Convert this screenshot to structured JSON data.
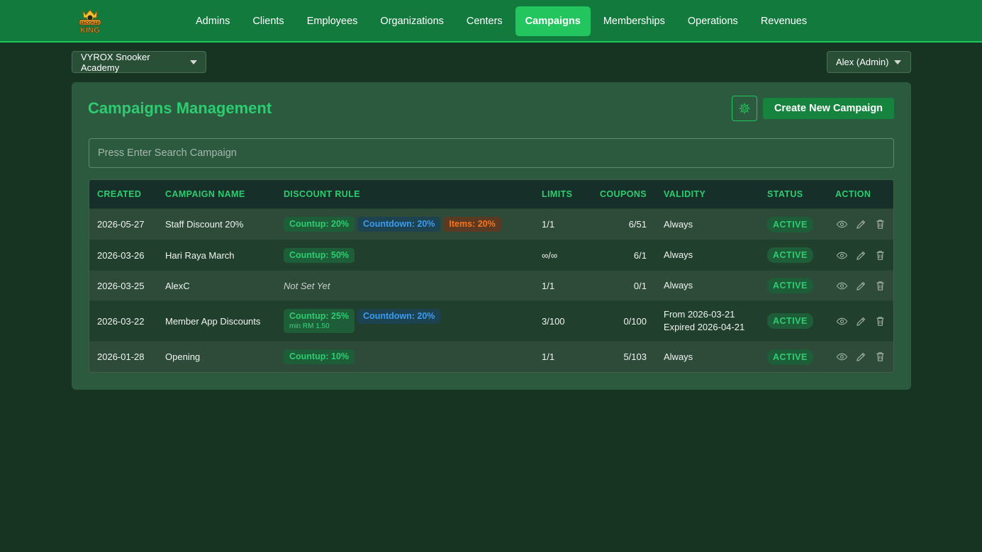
{
  "nav": {
    "logo_text": "SNOOKER KING",
    "items": [
      {
        "label": "Admins",
        "active": false
      },
      {
        "label": "Clients",
        "active": false
      },
      {
        "label": "Employees",
        "active": false
      },
      {
        "label": "Organizations",
        "active": false
      },
      {
        "label": "Centers",
        "active": false
      },
      {
        "label": "Campaigns",
        "active": true
      },
      {
        "label": "Memberships",
        "active": false
      },
      {
        "label": "Operations",
        "active": false
      },
      {
        "label": "Revenues",
        "active": false
      }
    ]
  },
  "org_select": {
    "value": "VYROX Snooker Academy"
  },
  "user_menu": {
    "label": "Alex (Admin)"
  },
  "page": {
    "title": "Campaigns Management",
    "create_label": "Create New Campaign",
    "search_placeholder": "Press Enter Search Campaign"
  },
  "table": {
    "headers": {
      "created": "CREATED",
      "name": "CAMPAIGN NAME",
      "rule": "DISCOUNT RULE",
      "limits": "LIMITS",
      "coupons": "COUPONS",
      "validity": "VALIDITY",
      "status": "STATUS",
      "action": "ACTION"
    },
    "rows": [
      {
        "created": "2026-05-27",
        "name": "Staff Discount 20%",
        "rules": [
          {
            "label": "Countup: 20%",
            "color": "green"
          },
          {
            "label": "Countdown: 20%",
            "color": "blue"
          },
          {
            "label": "Items: 20%",
            "color": "orange"
          }
        ],
        "limits": "1/1",
        "coupons": "6/51",
        "validity": [
          "Always"
        ],
        "status": "ACTIVE"
      },
      {
        "created": "2026-03-26",
        "name": "Hari Raya March",
        "rules": [
          {
            "label": "Countup: 50%",
            "color": "green"
          }
        ],
        "limits": "∞/∞",
        "coupons": "6/1",
        "validity": [
          "Always"
        ],
        "status": "ACTIVE"
      },
      {
        "created": "2026-03-25",
        "name": "AlexC",
        "rules": [],
        "rule_empty": "Not Set Yet",
        "limits": "1/1",
        "coupons": "0/1",
        "validity": [
          "Always"
        ],
        "status": "ACTIVE"
      },
      {
        "created": "2026-03-22",
        "name": "Member App Discounts",
        "rules": [
          {
            "label": "Countup: 25%",
            "sub": "min RM 1.50",
            "color": "green"
          },
          {
            "label": "Countdown: 20%",
            "color": "blue"
          }
        ],
        "limits": "3/100",
        "coupons": "0/100",
        "validity": [
          "From 2026-03-21",
          "Expired 2026-04-21"
        ],
        "status": "ACTIVE"
      },
      {
        "created": "2026-01-28",
        "name": "Opening",
        "rules": [
          {
            "label": "Countup: 10%",
            "color": "green"
          }
        ],
        "limits": "1/1",
        "coupons": "5/103",
        "validity": [
          "Always"
        ],
        "status": "ACTIVE"
      }
    ]
  },
  "icons": {
    "logo": "crown-logo-icon",
    "settings": "gear-icon",
    "view": "eye-icon",
    "edit": "pencil-icon",
    "delete": "trash-icon",
    "dropdown": "caret-down-icon"
  },
  "colors": {
    "nav_bg": "#137a3d",
    "accent": "#22c55e",
    "page_bg": "#173322",
    "card_bg": "#2b5a3e",
    "tag_green": "#2ecc71",
    "tag_blue": "#3b9bf0",
    "tag_orange": "#f97316"
  }
}
